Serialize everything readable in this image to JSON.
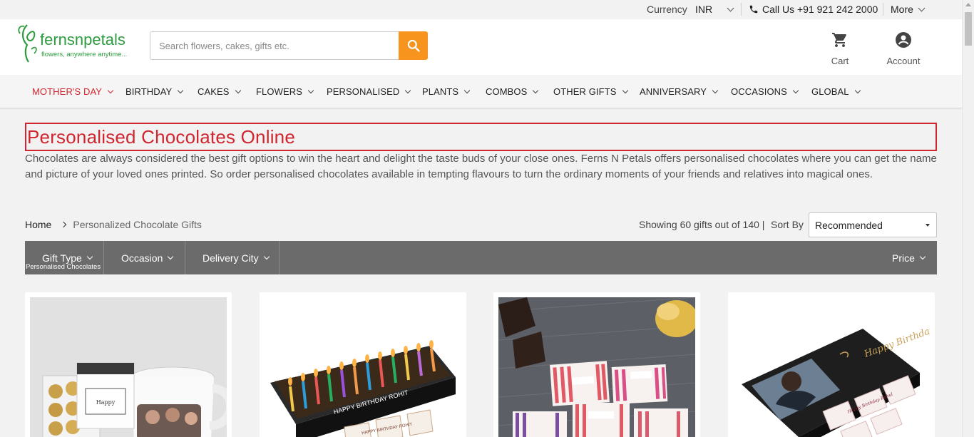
{
  "utility_bar": {
    "currency_label": "Currency",
    "currency_value": "INR",
    "call_text": "Call Us +91 921 242 2000",
    "more_label": "More"
  },
  "header": {
    "brand_name": "fernsnpetals",
    "brand_tagline": "flowers, anywhere anytime...",
    "search_placeholder": "Search flowers, cakes, gifts etc.",
    "cart_label": "Cart",
    "account_label": "Account",
    "accent_color": "#f7941d",
    "brand_color": "#2e9b3e"
  },
  "nav": {
    "items": [
      {
        "label": "MOTHER'S DAY",
        "active": true
      },
      {
        "label": "BIRTHDAY"
      },
      {
        "label": "CAKES"
      },
      {
        "label": "FLOWERS"
      },
      {
        "label": "PERSONALISED"
      },
      {
        "label": "PLANTS"
      },
      {
        "label": "COMBOS"
      },
      {
        "label": "OTHER GIFTS"
      },
      {
        "label": "ANNIVERSARY"
      },
      {
        "label": "OCCASIONS"
      },
      {
        "label": "GLOBAL"
      }
    ]
  },
  "page": {
    "title": "Personalised Chocolates Online",
    "description": "Chocolates are always considered the best gift options to win the heart and delight the taste buds of your close ones. Ferns N Petals offers personalised chocolates where you can get the name and picture of your loved ones printed. So order personalised chocolates available in tempting flavours to turn the ordinary moments of your friends and relatives into magical ones.",
    "title_color": "#d0262f"
  },
  "breadcrumb": {
    "home": "Home",
    "current": "Personalized Chocolate Gifts"
  },
  "results": {
    "showing_text": "Showing 60 gifts out of 140 |",
    "sort_label": "Sort By",
    "sort_value": "Recommended"
  },
  "filters": {
    "gift_type": "Gift Type",
    "gift_type_selected": "Personalised Chocolates",
    "occasion": "Occasion",
    "delivery_city": "Delivery City",
    "price": "Price"
  },
  "products": [
    {
      "image": "chocolate-box-and-photo-mug"
    },
    {
      "image": "birthday-candles-chocolate-box",
      "printed_text": "HAPPY BIRTHDAY ROHIT",
      "chip_text": "HAPPY BIRTHDAY ROHIT"
    },
    {
      "image": "striped-wrapped-chocolates"
    },
    {
      "image": "black-photo-chocolate-box",
      "printed_text": "Happy Birthday Rahul",
      "chip_text": "Happy Birthday Rahul"
    }
  ]
}
